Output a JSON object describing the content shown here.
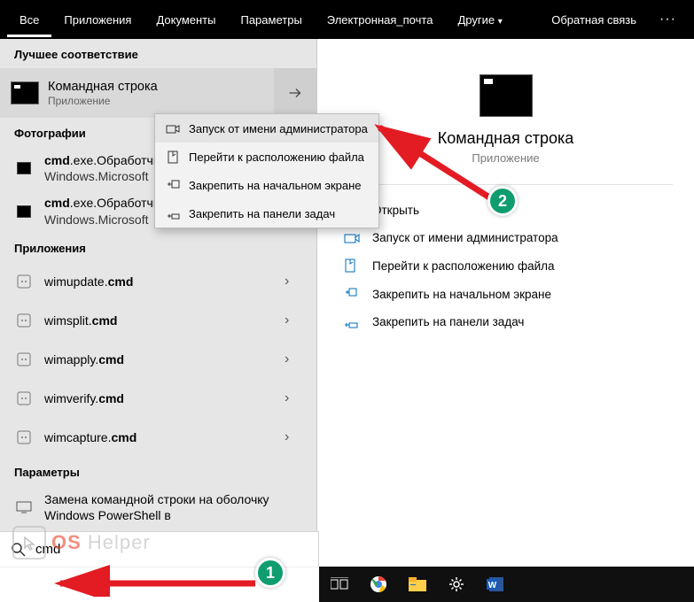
{
  "tabs": {
    "items": [
      "Все",
      "Приложения",
      "Документы",
      "Параметры",
      "Электронная_почта",
      "Другие"
    ],
    "feedback": "Обратная связь"
  },
  "sections": {
    "best": "Лучшее соответствие",
    "photos": "Фотографии",
    "apps": "Приложения",
    "settings": "Параметры"
  },
  "best_match": {
    "title": "Командная строка",
    "subtitle": "Приложение"
  },
  "photos": [
    {
      "pre": "cmd",
      "post": ".exe.Обработчи",
      "sub": "Windows.Microsoft"
    },
    {
      "pre": "cmd",
      "post": ".exe.Обработчик команд",
      "sub": "Windows.Microsoft"
    }
  ],
  "apps_list": [
    {
      "pre": "wimupdate.",
      "bold": "cmd"
    },
    {
      "pre": "wimsplit.",
      "bold": "cmd"
    },
    {
      "pre": "wimapply.",
      "bold": "cmd"
    },
    {
      "pre": "wimverify.",
      "bold": "cmd"
    },
    {
      "pre": "wimcapture.",
      "bold": "cmd"
    }
  ],
  "settings_row": "Замена командной строки на оболочку Windows PowerShell в",
  "context_menu": [
    "Запуск от имени администратора",
    "Перейти к расположению файла",
    "Закрепить на начальном экране",
    "Закрепить на панели задач"
  ],
  "preview": {
    "title": "Командная строка",
    "subtitle": "Приложение",
    "actions": [
      "Открыть",
      "Запуск от имени администратора",
      "Перейти к расположению файла",
      "Закрепить на начальном экране",
      "Закрепить на панели задач"
    ]
  },
  "search": {
    "value": "cmd"
  },
  "watermark": {
    "os": "OS",
    "rest": "Helper"
  },
  "badges": {
    "one": "1",
    "two": "2"
  }
}
